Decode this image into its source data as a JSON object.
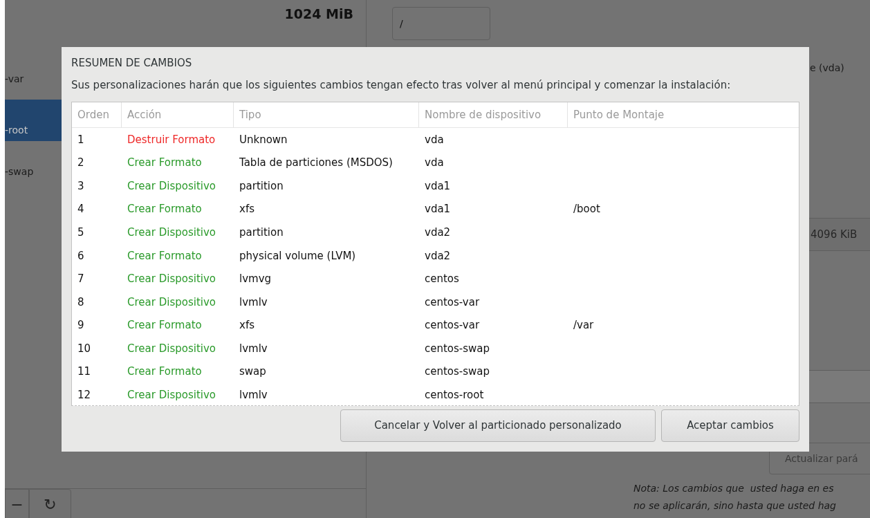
{
  "background": {
    "size_label": "1024 MiB",
    "mount_field": {
      "value": "/"
    },
    "device_list": [
      {
        "label": "-var",
        "selected": false
      },
      {
        "label": "-root",
        "selected": true
      },
      {
        "label": "-swap",
        "selected": false
      }
    ],
    "disk_label": "e (vda)",
    "block_size": "4096 KiB",
    "update_button": "Actualizar pará",
    "note": [
      "Nota: Los cambios que  usted haga en es",
      "no se aplicarán, sino hasta que usted hag"
    ],
    "toolbar": [
      "−",
      "↻"
    ]
  },
  "dialog": {
    "title": "RESUMEN DE CAMBIOS",
    "description": "Sus personalizaciones harán que los siguientes cambios tengan efecto tras volver al menú principal y comenzar la instalación:",
    "table": {
      "columns": [
        "Orden",
        "Acción",
        "Tipo",
        "Nombre de dispositivo",
        "Punto de Montaje"
      ],
      "rows": [
        {
          "order": "1",
          "action": "Destruir Formato",
          "kind": "destroy",
          "type": "Unknown",
          "device": "vda",
          "mount": ""
        },
        {
          "order": "2",
          "action": "Crear Formato",
          "kind": "create",
          "type": "Tabla de particiones (MSDOS)",
          "device": "vda",
          "mount": ""
        },
        {
          "order": "3",
          "action": "Crear Dispositivo",
          "kind": "create",
          "type": "partition",
          "device": "vda1",
          "mount": ""
        },
        {
          "order": "4",
          "action": "Crear Formato",
          "kind": "create",
          "type": "xfs",
          "device": "vda1",
          "mount": "/boot"
        },
        {
          "order": "5",
          "action": "Crear Dispositivo",
          "kind": "create",
          "type": "partition",
          "device": "vda2",
          "mount": ""
        },
        {
          "order": "6",
          "action": "Crear Formato",
          "kind": "create",
          "type": "physical volume (LVM)",
          "device": "vda2",
          "mount": ""
        },
        {
          "order": "7",
          "action": "Crear Dispositivo",
          "kind": "create",
          "type": "lvmvg",
          "device": "centos",
          "mount": ""
        },
        {
          "order": "8",
          "action": "Crear Dispositivo",
          "kind": "create",
          "type": "lvmlv",
          "device": "centos-var",
          "mount": ""
        },
        {
          "order": "9",
          "action": "Crear Formato",
          "kind": "create",
          "type": "xfs",
          "device": "centos-var",
          "mount": "/var"
        },
        {
          "order": "10",
          "action": "Crear Dispositivo",
          "kind": "create",
          "type": "lvmlv",
          "device": "centos-swap",
          "mount": ""
        },
        {
          "order": "11",
          "action": "Crear Formato",
          "kind": "create",
          "type": "swap",
          "device": "centos-swap",
          "mount": ""
        },
        {
          "order": "12",
          "action": "Crear Dispositivo",
          "kind": "create",
          "type": "lvmlv",
          "device": "centos-root",
          "mount": ""
        }
      ]
    },
    "buttons": [
      "Cancelar y Volver al particionado personalizado",
      "Aceptar cambios"
    ]
  }
}
